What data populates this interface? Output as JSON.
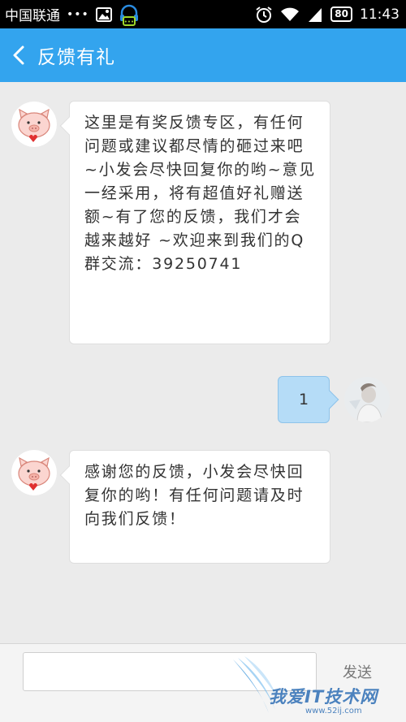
{
  "status_bar": {
    "carrier": "中国联通",
    "dots": "•••",
    "battery": "80",
    "time": "11:43"
  },
  "header": {
    "title": "反馈有礼"
  },
  "messages": [
    {
      "side": "left",
      "text": "这里是有奖反馈专区，有任何问题或建议都尽情的砸过来吧~小发会尽快回复你的哟~意见一经采用，将有超值好礼赠送额~有了您的反馈，我们才会越来越好 ~欢迎来到我们的Q群交流：39250741"
    },
    {
      "side": "right",
      "text": "1"
    },
    {
      "side": "left",
      "text": "感谢您的反馈，小发会尽快回复你的哟！有任何问题请及时向我们反馈！"
    }
  ],
  "input": {
    "value": "",
    "send_label": "发送"
  },
  "watermark": {
    "text": "我爱IT技术网",
    "url": "www.52ij.com"
  },
  "colors": {
    "header": "#33a4ee",
    "background": "#ebebeb",
    "user_bubble": "#b5dcf7"
  }
}
